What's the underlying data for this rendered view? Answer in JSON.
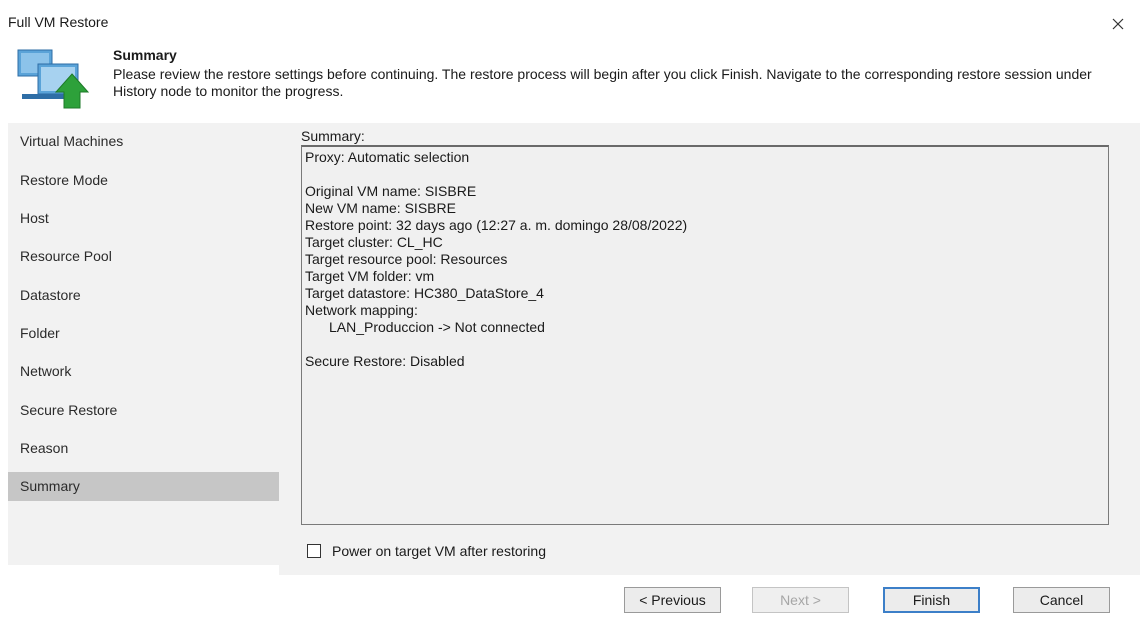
{
  "window": {
    "title": "Full VM Restore"
  },
  "header": {
    "title": "Summary",
    "description": "Please review the restore settings before continuing. The restore process will begin after you click Finish. Navigate to the corresponding restore session under History node to monitor the progress.",
    "icon": "vm-restore-icon"
  },
  "sidebar": {
    "items": [
      {
        "label": "Virtual Machines"
      },
      {
        "label": "Restore Mode"
      },
      {
        "label": "Host"
      },
      {
        "label": "Resource Pool"
      },
      {
        "label": "Datastore"
      },
      {
        "label": "Folder"
      },
      {
        "label": "Network"
      },
      {
        "label": "Secure Restore"
      },
      {
        "label": "Reason"
      },
      {
        "label": "Summary"
      }
    ],
    "active_index": 9
  },
  "summary": {
    "label": "Summary:",
    "lines": {
      "proxy": "Proxy: Automatic selection",
      "original_vm": "Original VM name: SISBRE",
      "new_vm": "New VM name: SISBRE",
      "restore_point": "Restore point: 32 days ago (12:27 a. m. domingo 28/08/2022)",
      "target_cluster": "Target cluster: CL_HC",
      "target_pool": "Target resource pool: Resources",
      "target_folder": "Target VM folder: vm",
      "target_datastore": "Target datastore: HC380_DataStore_4",
      "network_mapping": "Network mapping:",
      "network_entry": "LAN_Produccion -> Not connected",
      "secure_restore": "Secure Restore: Disabled"
    }
  },
  "power_on": {
    "label": "Power on target VM after restoring",
    "checked": false
  },
  "buttons": {
    "previous": "< Previous",
    "next": "Next >",
    "finish": "Finish",
    "cancel": "Cancel"
  },
  "colors": {
    "accent": "#3c7fc8",
    "active_item": "#c6c6c6",
    "panel": "#f2f2f2"
  }
}
